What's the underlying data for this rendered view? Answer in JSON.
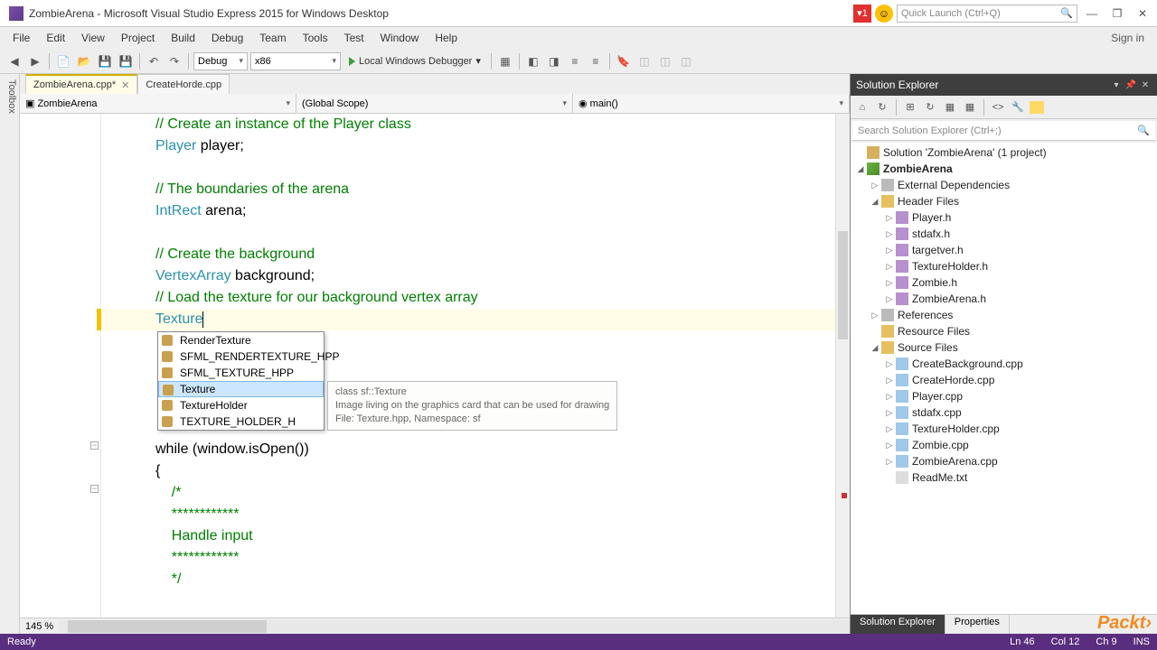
{
  "titlebar": {
    "title": "ZombieArena - Microsoft Visual Studio Express 2015 for Windows Desktop",
    "notif": "1",
    "quicklaunch_ph": "Quick Launch (Ctrl+Q)"
  },
  "menus": [
    "File",
    "Edit",
    "View",
    "Project",
    "Build",
    "Debug",
    "Team",
    "Tools",
    "Test",
    "Window",
    "Help"
  ],
  "signin": "Sign in",
  "toolbar": {
    "config": "Debug",
    "platform": "x86",
    "debugger": "Local Windows Debugger"
  },
  "toolbox": "Toolbox",
  "tabs": [
    {
      "name": "ZombieArena.cpp*",
      "active": true
    },
    {
      "name": "CreateHorde.cpp",
      "active": false
    }
  ],
  "scope": {
    "project": "ZombieArena",
    "namespace": "(Global Scope)",
    "func": "main()"
  },
  "code_lines": [
    {
      "t": "// Create an instance of the Player class",
      "cls": "cm"
    },
    {
      "raw": "<span class='kw'>Player</span> player;"
    },
    {
      "t": ""
    },
    {
      "t": "// The boundaries of the arena",
      "cls": "cm"
    },
    {
      "raw": "<span class='kw'>IntRect</span> arena;"
    },
    {
      "t": ""
    },
    {
      "t": "// Create the background",
      "cls": "cm"
    },
    {
      "raw": "<span class='kw'>VertexArray</span> background;"
    },
    {
      "t": "// Load the texture for our background vertex array",
      "cls": "cm"
    },
    {
      "raw": "<span class='kw'>Texture</span><span class='cursor'></span>",
      "current": true
    },
    {
      "t": ""
    },
    {
      "t": ""
    },
    {
      "t": ""
    },
    {
      "t": ""
    },
    {
      "t": ""
    },
    {
      "t": "while (window.isOpen())"
    },
    {
      "t": "{"
    },
    {
      "t": "    /*",
      "cls": "cm"
    },
    {
      "t": "    ************",
      "cls": "cm"
    },
    {
      "t": "    Handle input",
      "cls": "cm"
    },
    {
      "t": "    ************",
      "cls": "cm"
    },
    {
      "t": "    */",
      "cls": "cm"
    }
  ],
  "intellisense": {
    "items": [
      "RenderTexture",
      "SFML_RENDERTEXTURE_HPP",
      "SFML_TEXTURE_HPP",
      "Texture",
      "TextureHolder",
      "TEXTURE_HOLDER_H"
    ],
    "selected": 3,
    "tooltip": {
      "l1": "class sf::Texture",
      "l2": "Image living on the graphics card that can be used for drawing",
      "l3": "File: Texture.hpp, Namespace: sf"
    }
  },
  "zoom": "145 %",
  "solex": {
    "title": "Solution Explorer",
    "search_ph": "Search Solution Explorer (Ctrl+;)",
    "sln": "Solution 'ZombieArena' (1 project)",
    "project": "ZombieArena",
    "ext_deps": "External Dependencies",
    "hdr_folder": "Header Files",
    "headers": [
      "Player.h",
      "stdafx.h",
      "targetver.h",
      "TextureHolder.h",
      "Zombie.h",
      "ZombieArena.h"
    ],
    "references": "References",
    "resources": "Resource Files",
    "src_folder": "Source Files",
    "sources": [
      "CreateBackground.cpp",
      "CreateHorde.cpp",
      "Player.cpp",
      "stdafx.cpp",
      "TextureHolder.cpp",
      "Zombie.cpp",
      "ZombieArena.cpp"
    ],
    "readme": "ReadMe.txt",
    "tabs": [
      "Solution Explorer",
      "Properties"
    ]
  },
  "status": {
    "ready": "Ready",
    "ln": "Ln 46",
    "col": "Col 12",
    "ch": "Ch 9",
    "ins": "INS"
  },
  "packt": "Packt›"
}
